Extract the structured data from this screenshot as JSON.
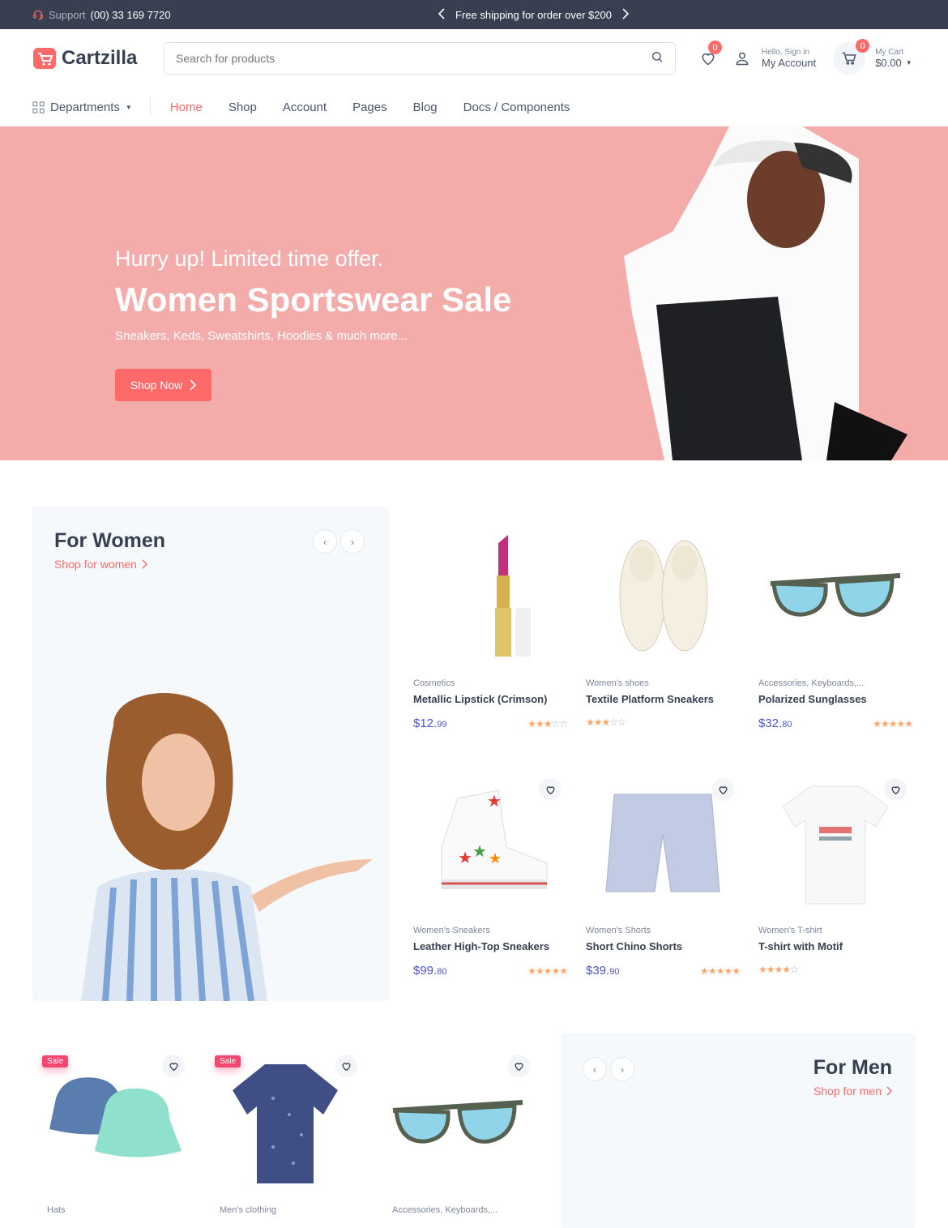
{
  "topbar": {
    "support_label": "Support",
    "support_phone": "(00) 33 169 7720",
    "promo": "Free shipping for order over $200"
  },
  "header": {
    "logo": "Cartzilla",
    "search_placeholder": "Search for products",
    "wishlist_count": "0",
    "greeting": "Hello, Sign in",
    "account": "My Account",
    "cart_count": "0",
    "cart_label": "My Cart",
    "cart_total": "$0.00"
  },
  "nav": {
    "departments": "Departments",
    "links": [
      "Home",
      "Shop",
      "Account",
      "Pages",
      "Blog",
      "Docs / Components"
    ]
  },
  "hero": {
    "subtitle": "Hurry up! Limited time offer.",
    "title": "Women Sportswear Sale",
    "desc": "Sneakers, Keds, Sweatshirts, Hoodies & much more...",
    "button": "Shop Now"
  },
  "women": {
    "title": "For Women",
    "link": "Shop for women",
    "products": [
      {
        "cat": "Cosmetics",
        "name": "Metallic Lipstick (Crimson)",
        "price": "$12.",
        "cents": "99",
        "rating": 3
      },
      {
        "cat": "Women's shoes",
        "name": "Textile Platform Sneakers",
        "price": "",
        "cents": "",
        "rating": 3
      },
      {
        "cat": "Accessories, Keyboards,...",
        "name": "Polarized Sunglasses",
        "price": "$32.",
        "cents": "80",
        "rating": 5
      },
      {
        "cat": "Women's Sneakers",
        "name": "Leather High-Top Sneakers",
        "price": "$99.",
        "cents": "80",
        "rating": 5
      },
      {
        "cat": "Women's Shorts",
        "name": "Short Chino Shorts",
        "price": "$39.",
        "cents": "90",
        "rating": 5
      },
      {
        "cat": "Women's T-shirt",
        "name": "T-shirt with Motif",
        "price": "",
        "cents": "",
        "rating": 4
      }
    ]
  },
  "men": {
    "title": "For Men",
    "link": "Shop for men",
    "products": [
      {
        "cat": "Hats",
        "sale": "Sale"
      },
      {
        "cat": "Men's clothing",
        "sale": "Sale"
      },
      {
        "cat": "Accessories, Keyboards,..."
      }
    ]
  },
  "colors": {
    "accent": "#fe696a",
    "dark": "#373f50",
    "hero_bg": "#f3acaa",
    "price": "#4e54c8",
    "star": "#fea569"
  }
}
